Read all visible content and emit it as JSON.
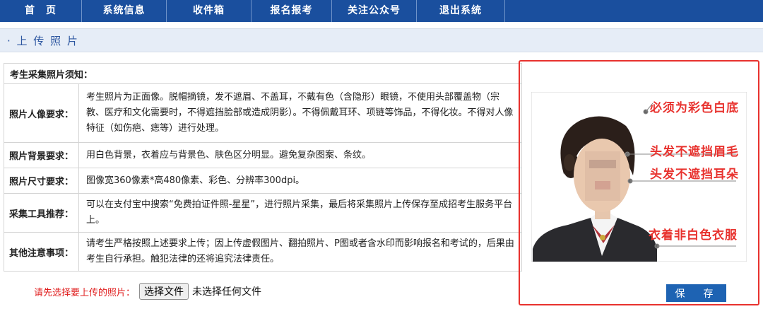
{
  "nav": {
    "items": [
      "首　页",
      "系统信息",
      "收件箱",
      "报名报考",
      "关注公众号",
      "退出系统"
    ]
  },
  "section": {
    "title": "· 上 传 照 片"
  },
  "notice": {
    "heading": "考生采集照片须知：",
    "rows": [
      {
        "label": "照片人像要求：",
        "text": "考生照片为正面像。脱帽摘镜，发不遮眉、不盖耳，不戴有色（含隐形）眼镜，不使用头部覆盖物（宗教、医疗和文化需要时，不得遮挡脸部或造成阴影）。不得佩戴耳环、项链等饰品，不得化妆。不得对人像特征（如伤疤、痣等）进行处理。"
      },
      {
        "label": "照片背景要求：",
        "text": "用白色背景，衣着应与背景色、肤色区分明显。避免复杂图案、条纹。"
      },
      {
        "label": "照片尺寸要求：",
        "text": "图像宽360像素*高480像素、彩色、分辨率300dpi。"
      },
      {
        "label": "采集工具推荐：",
        "text": "可以在支付宝中搜索“免费拍证件照-星星”，进行照片采集，最后将采集照片上传保存至成招考生服务平台上。"
      },
      {
        "label": "其他注意事项：",
        "text": "请考生严格按照上述要求上传；因上传虚假图片、翻拍照片、P图或者含水印而影响报名和考试的，后果由考生自行承担。触犯法律的还将追究法律责任。"
      }
    ]
  },
  "upload": {
    "label": "请先选择要上传的照片：",
    "button": "选择文件",
    "status": "未选择任何文件"
  },
  "photo_notes": [
    "必须为彩色白底",
    "头发不遮挡眉毛",
    "头发不遮挡耳朵",
    "衣着非白色衣服"
  ],
  "save_button": "保　存"
}
